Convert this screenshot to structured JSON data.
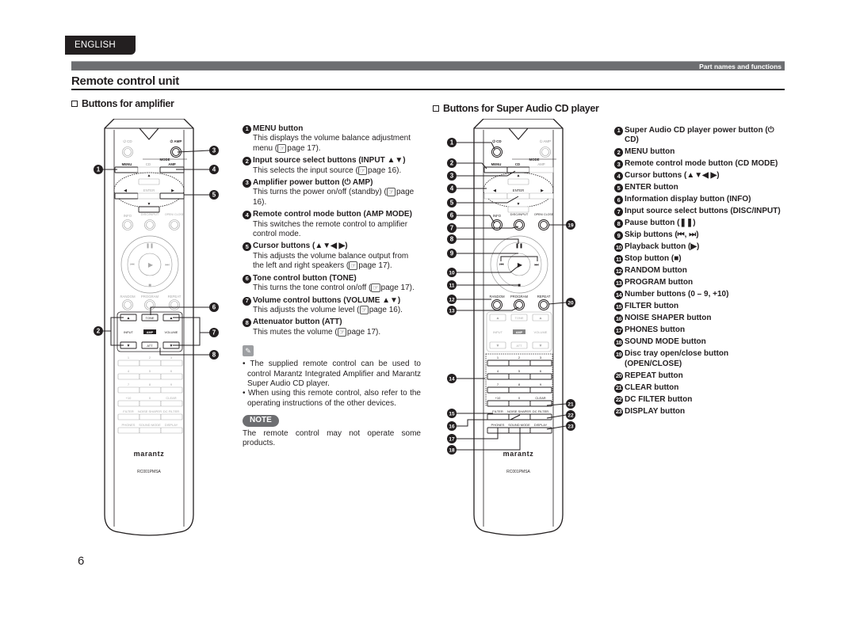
{
  "header": {
    "language_tab": "ENGLISH",
    "section_label": "Part names and functions",
    "page_title": "Remote control unit"
  },
  "amp_section": {
    "heading": "Buttons for amplifier",
    "items": [
      {
        "num": "1",
        "title": "MENU button",
        "body": "This displays the volume balance adjustment menu (",
        "ref": "page 17)."
      },
      {
        "num": "2",
        "title": "Input source select buttons (INPUT ▲▼)",
        "body": "This selects the input source (",
        "ref": "page 16)."
      },
      {
        "num": "3",
        "title": "Amplifier power button (⏻ AMP)",
        "body": "This turns the power on/off (standby) (",
        "ref": "page 16)."
      },
      {
        "num": "4",
        "title": "Remote control mode button (AMP MODE)",
        "body": "This switches the remote control to amplifier control mode.",
        "ref": ""
      },
      {
        "num": "5",
        "title": "Cursor buttons (▲▼◀ ▶)",
        "body": "This adjusts the volume balance output from the left and right speakers (",
        "ref": "page 17)."
      },
      {
        "num": "6",
        "title": "Tone control button (TONE)",
        "body": "This turns  the tone control on/off (",
        "ref": "page 17)."
      },
      {
        "num": "7",
        "title": "Volume control buttons (VOLUME ▲▼)",
        "body": "This adjusts the volume level (",
        "ref": "page 16)."
      },
      {
        "num": "8",
        "title": "Attenuator button (ATT)",
        "body": "This mutes the volume (",
        "ref": "page 17)."
      }
    ],
    "notes": [
      "The supplied remote control can be used to control Marantz Integrated Amplifier and Marantz Super Audio CD player.",
      "When using this remote control, also refer to the operating instructions of the other devices."
    ],
    "note_badge": "NOTE",
    "note_text": "The remote control may not operate some products."
  },
  "cd_section": {
    "heading": "Buttons for Super Audio CD player",
    "items": [
      {
        "num": "1",
        "title": "Super Audio CD player power button (⏻ CD)"
      },
      {
        "num": "2",
        "title": "MENU button"
      },
      {
        "num": "3",
        "title": "Remote control mode button (CD MODE)"
      },
      {
        "num": "4",
        "title": "Cursor buttons (▲▼◀ ▶)"
      },
      {
        "num": "5",
        "title": "ENTER button"
      },
      {
        "num": "6",
        "title": "Information display button (INFO)"
      },
      {
        "num": "7",
        "title": "Input source select buttons (DISC/INPUT)"
      },
      {
        "num": "8",
        "title": "Pause button (❚❚)"
      },
      {
        "num": "9",
        "title": "Skip buttons (⏮, ⏭)"
      },
      {
        "num": "10",
        "title": "Playback button (▶)"
      },
      {
        "num": "11",
        "title": "Stop button (■)"
      },
      {
        "num": "12",
        "title": "RANDOM button"
      },
      {
        "num": "13",
        "title": "PROGRAM button"
      },
      {
        "num": "14",
        "title": "Number buttons (0 – 9, +10)"
      },
      {
        "num": "15",
        "title": "FILTER button"
      },
      {
        "num": "16",
        "title": "NOISE SHAPER button"
      },
      {
        "num": "17",
        "title": "PHONES button"
      },
      {
        "num": "18",
        "title": "SOUND MODE button"
      },
      {
        "num": "19",
        "title": "Disc tray open/close button (OPEN/CLOSE)"
      },
      {
        "num": "20",
        "title": "REPEAT button"
      },
      {
        "num": "21",
        "title": "CLEAR button"
      },
      {
        "num": "22",
        "title": "DC FILTER button"
      },
      {
        "num": "23",
        "title": "DISPLAY button"
      }
    ]
  },
  "remote": {
    "labels": {
      "cd_power": "⏻ CD",
      "amp_power": "⏻ AMP",
      "mode": "MODE",
      "menu": "MENU",
      "cd": "CD",
      "amp": "AMP",
      "enter": "ENTER",
      "info": "INFO",
      "disc_input": "DISC/INPUT",
      "open_close": "OPEN/ CLOSE",
      "random": "RANDOM",
      "program": "PROGRAM",
      "repeat": "REPEAT",
      "tone": "TONE",
      "input": "INPUT",
      "amp_badge": "AMP",
      "volume": "VOLUME",
      "att": "ATT",
      "n1": "1",
      "n2": "2",
      "n3": "3",
      "n4": "4",
      "n5": "5",
      "n6": "6",
      "n7": "7",
      "n8": "8",
      "n9": "9",
      "plus10": "+10",
      "n0": "0",
      "clear": "CLEAR",
      "filter": "FILTER",
      "noise_shaper": "NOISE SHAPER",
      "dc_filter": "DC FILTER",
      "phones": "PHONES",
      "sound_mode": "SOUND MODE",
      "display": "DISPLAY",
      "brand": "marantz",
      "model": "RC001PMSA"
    }
  },
  "footer": {
    "page_number": "6"
  }
}
